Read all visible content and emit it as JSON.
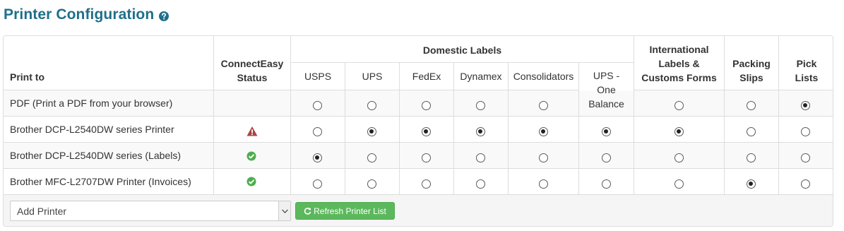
{
  "header": {
    "title": "Printer Configuration",
    "help_icon": "question-circle-icon"
  },
  "table": {
    "col_print_to": "Print to",
    "col_status": [
      "ConnectEasy",
      "Status"
    ],
    "group_domestic": "Domestic Labels",
    "domestic_columns": [
      "USPS",
      "UPS",
      "FedEx",
      "Dynamex",
      "Consolidators",
      "UPS - One Balance"
    ],
    "ups_one_balance_lines": [
      "UPS -",
      "One",
      "Balance"
    ],
    "col_international": [
      "International",
      "Labels &",
      "Customs Forms"
    ],
    "col_packing": [
      "Packing",
      "Slips"
    ],
    "col_pick": [
      "Pick",
      "Lists"
    ],
    "rows": [
      {
        "name": "PDF (Print a PDF from your browser)",
        "status": "",
        "selected": [
          false,
          false,
          false,
          false,
          false,
          null,
          false,
          false,
          true
        ]
      },
      {
        "name": "Brother DCP-L2540DW series Printer",
        "status": "warning-icon",
        "selected": [
          false,
          true,
          true,
          true,
          true,
          true,
          true,
          false,
          false
        ]
      },
      {
        "name": "Brother DCP-L2540DW series (Labels)",
        "status": "check-circle-icon",
        "selected": [
          true,
          false,
          false,
          false,
          false,
          false,
          false,
          false,
          false
        ]
      },
      {
        "name": "Brother MFC-L2707DW Printer (Invoices)",
        "status": "check-circle-icon",
        "selected": [
          false,
          false,
          false,
          false,
          false,
          false,
          false,
          true,
          false
        ]
      }
    ]
  },
  "footer": {
    "add_printer_value": "Add Printer",
    "refresh_label": "Refresh Printer List",
    "refresh_icon": "refresh-icon"
  },
  "colors": {
    "title": "#1f6f8b",
    "button": "#5cb85c",
    "success": "#4cae4c",
    "warning": "#a94442"
  }
}
